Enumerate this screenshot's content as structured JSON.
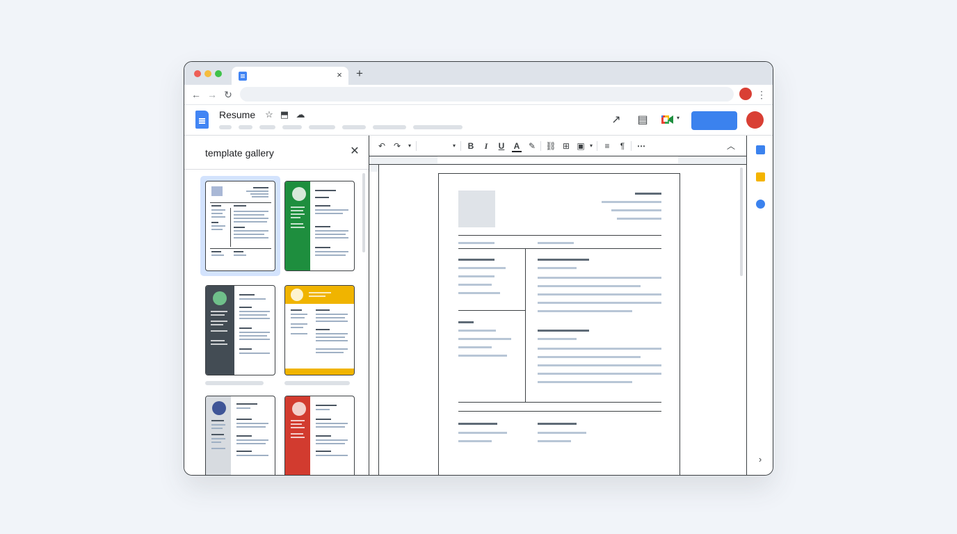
{
  "browser": {
    "traffic_lights": [
      "#ee5f57",
      "#f5bd3f",
      "#3fc24a"
    ],
    "tab": {
      "favicon": "docs-favicon",
      "close_glyph": "×"
    },
    "new_tab_glyph": "+",
    "nav": {
      "back_glyph": "←",
      "forward_glyph": "→",
      "reload_glyph": "↻"
    },
    "menu_glyph": "⋮"
  },
  "docs": {
    "title": "Resume",
    "icons": {
      "star": "☆",
      "move": "⬒",
      "cloud": "☁",
      "activity": "↗",
      "comments": "▤",
      "meet_caret": "▾"
    }
  },
  "template_panel": {
    "title": "template gallery",
    "close_glyph": "✕",
    "templates": [
      {
        "name": "template-serif",
        "accent": "#9aa9c8",
        "selected": true
      },
      {
        "name": "template-green",
        "accent": "#1e8e3e",
        "selected": false
      },
      {
        "name": "template-charcoal",
        "accent": "#434c54",
        "selected": false
      },
      {
        "name": "template-yellow",
        "accent": "#f0b400",
        "selected": false
      },
      {
        "name": "template-gray",
        "accent": "#d7dbe0",
        "selected": false
      },
      {
        "name": "template-red",
        "accent": "#d23b2f",
        "selected": false
      }
    ]
  },
  "toolbar": {
    "undo": "↶",
    "redo": "↷",
    "caret": "▾",
    "bold": "B",
    "italic": "I",
    "underline": "U",
    "text_color": "A",
    "highlight": "✎",
    "link": "⛓",
    "comment": "⊞",
    "image": "▣",
    "align": "≡",
    "format": "¶",
    "more": "⋯",
    "collapse": "︿"
  },
  "right_sidebar": {
    "expand_glyph": "›"
  },
  "colors": {
    "accent_blue": "#3b82ee",
    "avatar_red": "#d93f34"
  }
}
